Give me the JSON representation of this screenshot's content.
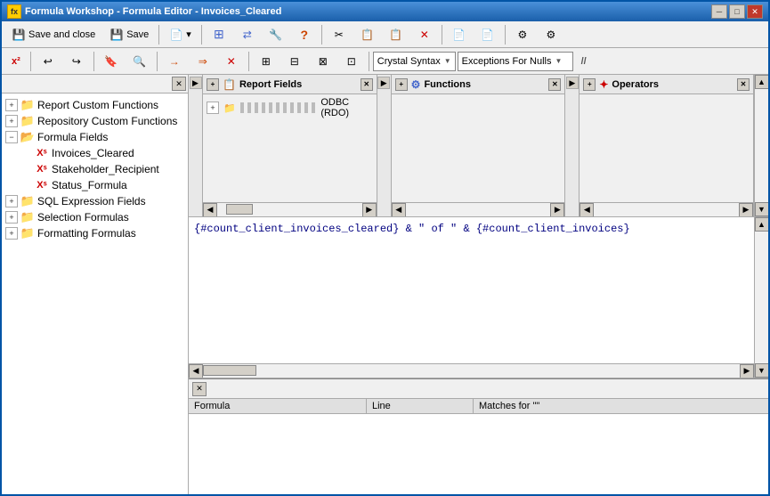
{
  "window": {
    "title": "Formula Workshop - Formula Editor - Invoices_Cleared",
    "icon": "fx"
  },
  "toolbar1": {
    "save_close_label": "Save and close",
    "save_label": "Save",
    "dropdown_label": ""
  },
  "toolbar2": {
    "syntax_label": "Crystal Syntax",
    "nulls_label": "Exceptions For Nulls",
    "comment_label": "//"
  },
  "left_panel": {
    "items": [
      {
        "label": "Report Custom Functions",
        "type": "folder",
        "indent": 0,
        "expanded": false
      },
      {
        "label": "Repository Custom Functions",
        "type": "folder",
        "indent": 0,
        "expanded": false
      },
      {
        "label": "Formula Fields",
        "type": "folder",
        "indent": 0,
        "expanded": true
      },
      {
        "label": "Invoices_Cleared",
        "type": "formula",
        "indent": 1
      },
      {
        "label": "Stakeholder_Recipient",
        "type": "formula",
        "indent": 1
      },
      {
        "label": "Status_Formula",
        "type": "formula",
        "indent": 1
      },
      {
        "label": "SQL Expression Fields",
        "type": "folder",
        "indent": 0,
        "expanded": false
      },
      {
        "label": "Selection Formulas",
        "type": "folder",
        "indent": 0,
        "expanded": false
      },
      {
        "label": "Formatting Formulas",
        "type": "folder",
        "indent": 0,
        "expanded": false
      }
    ]
  },
  "fields_pane": {
    "sections": [
      {
        "title": "Report Fields",
        "icon": "📋",
        "items": [
          {
            "label": "ODBC (RDO)",
            "icon": "db"
          }
        ]
      },
      {
        "title": "Functions",
        "icon": "⚙",
        "items": []
      },
      {
        "title": "Operators",
        "icon": "➕",
        "items": []
      }
    ]
  },
  "formula_editor": {
    "content": "{#count_client_invoices_cleared} & \" of \" & {#count_client_invoices}"
  },
  "bottom_panel": {
    "columns": [
      {
        "label": "Formula"
      },
      {
        "label": "Line"
      },
      {
        "label": "Matches for \"\""
      }
    ]
  },
  "title_buttons": {
    "minimize": "─",
    "maximize": "□",
    "close": "✕"
  }
}
